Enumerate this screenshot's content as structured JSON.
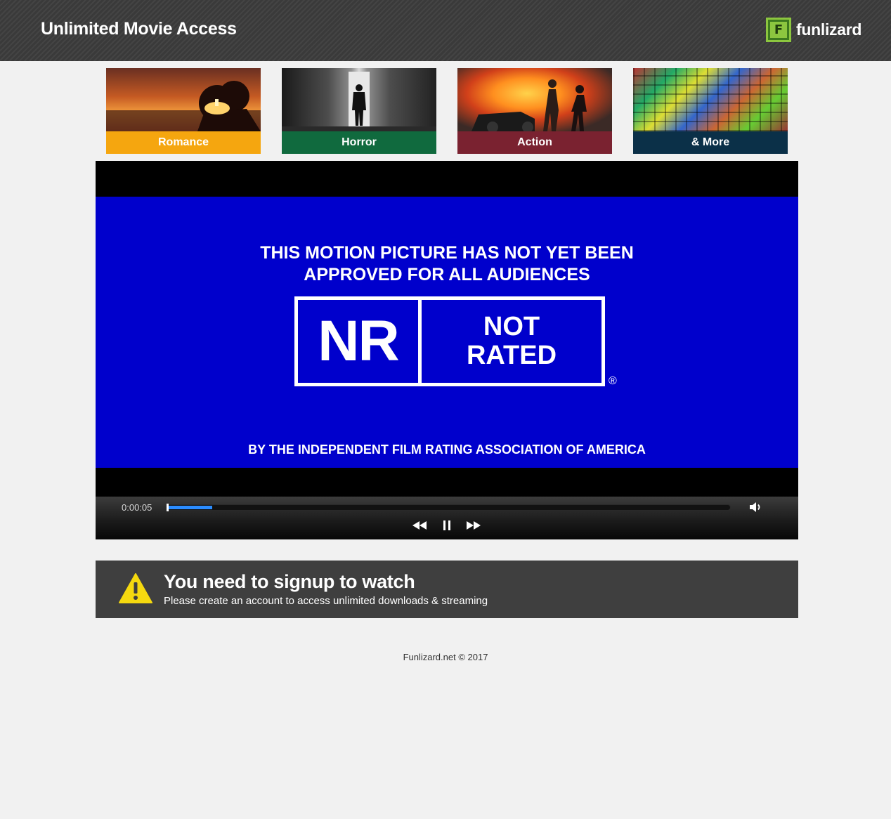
{
  "header": {
    "title": "Unlimited Movie Access",
    "brand_logo_letter": "F",
    "brand_name": "funlizard"
  },
  "genres": [
    {
      "label": "Romance",
      "color": "#f5a60f"
    },
    {
      "label": "Horror",
      "color": "#106a3e"
    },
    {
      "label": "Action",
      "color": "#7a2230"
    },
    {
      "label": "& More",
      "color": "#0b3048"
    }
  ],
  "player": {
    "rating_card": {
      "headline_line1": "THIS MOTION PICTURE HAS NOT YET BEEN",
      "headline_line2": "APPROVED FOR ALL AUDIENCES",
      "rating_code": "NR",
      "rating_desc_line1": "NOT",
      "rating_desc_line2": "RATED",
      "registered_mark": "®",
      "authority": "BY THE INDEPENDENT FILM RATING ASSOCIATION OF AMERICA",
      "background_color": "#0000cc"
    },
    "controls": {
      "time": "0:00:05",
      "progress_fraction": 0.08,
      "accent_color": "#2a8cff",
      "icons": [
        "volume-icon",
        "rewind-icon",
        "pause-icon",
        "fast-forward-icon"
      ]
    }
  },
  "signup": {
    "icon": "warning-icon",
    "title": "You need to signup to watch",
    "subtitle": "Please create an account to access unlimited downloads & streaming"
  },
  "footer": {
    "text": "Funlizard.net © 2017"
  }
}
